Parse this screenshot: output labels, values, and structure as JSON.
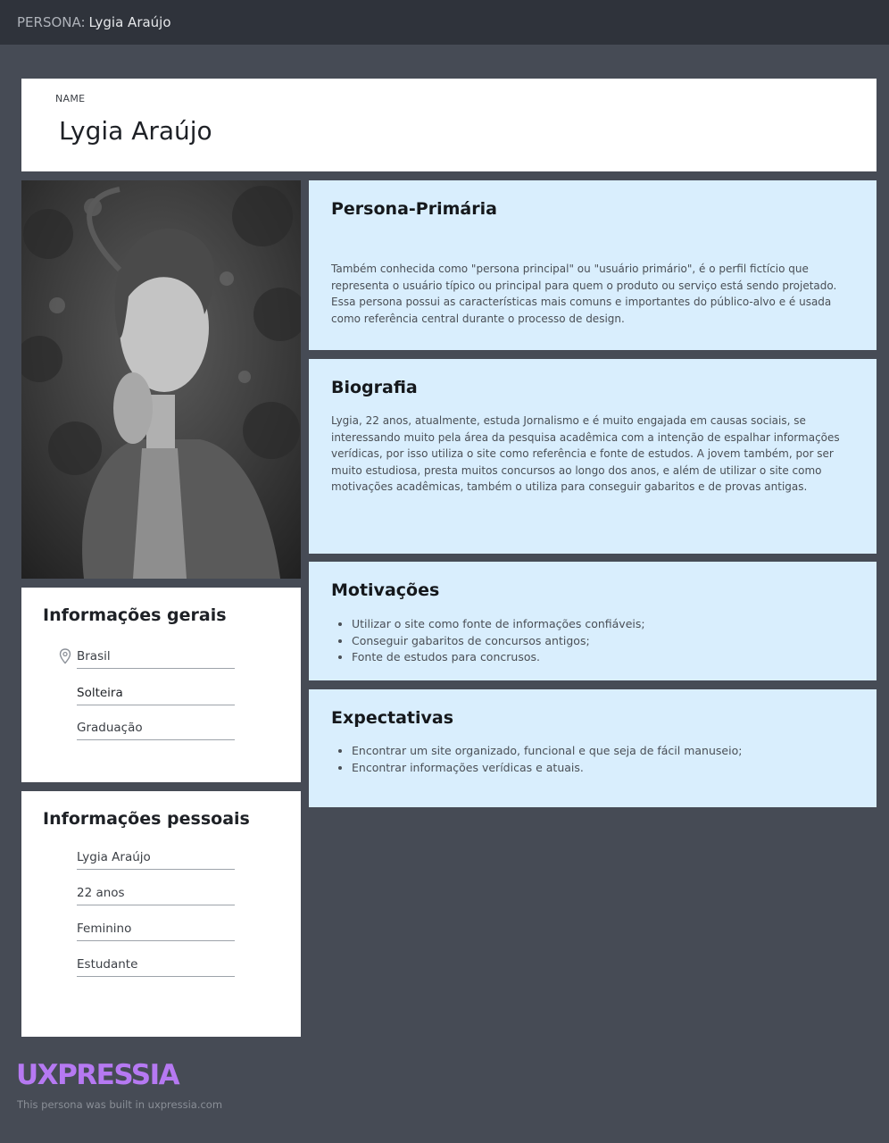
{
  "topbar": {
    "prefix": "PERSONA:",
    "name": "Lygia Araújo"
  },
  "name_card": {
    "label": "NAME",
    "value": "Lygia Araújo"
  },
  "general_info": {
    "title": "Informações gerais",
    "location_icon": "map-pin-icon",
    "fields": [
      "Brasil",
      "Solteira",
      "Graduação"
    ]
  },
  "personal_info": {
    "title": "Informações pessoais",
    "fields": [
      "Lygia Araújo",
      "22 anos",
      "Feminino",
      "Estudante"
    ]
  },
  "primary": {
    "title": "Persona-Primária",
    "text": "Também conhecida como \"persona principal\" ou \"usuário primário\", é o perfil fictício que representa o usuário típico ou principal para quem o produto ou serviço está sendo projetado. Essa persona possui as características mais comuns e importantes do público-alvo e é usada como referência central durante o processo de design."
  },
  "biography": {
    "title": "Biografia",
    "text": "Lygia, 22 anos, atualmente, estuda Jornalismo e é muito engajada em causas sociais, se interessando muito pela área da pesquisa acadêmica com a intenção de espalhar informações verídicas, por isso utiliza o site como referência e fonte de estudos. A jovem também, por ser muito estudiosa, presta muitos concursos ao longo dos anos, e além de utilizar o site como motivações acadêmicas, também o utiliza para conseguir gabaritos e de provas antigas."
  },
  "motivations": {
    "title": "Motivações",
    "items": [
      "Utilizar o site como fonte de informações confiáveis;",
      "Conseguir gabaritos de concursos antigos;",
      "Fonte de estudos para concrusos."
    ]
  },
  "expectations": {
    "title": "Expectativas",
    "items": [
      "Encontrar um site organizado, funcional e que seja de fácil manuseio;",
      "Encontrar informações verídicas e atuais."
    ]
  },
  "footer": {
    "brand": "UXPRESSIA",
    "note": "This persona was built in uxpressia.com"
  },
  "colors": {
    "background": "#464b55",
    "topbar": "#2f333b",
    "section_blue": "#d9eefd",
    "brand_purple": "#b679f2"
  }
}
